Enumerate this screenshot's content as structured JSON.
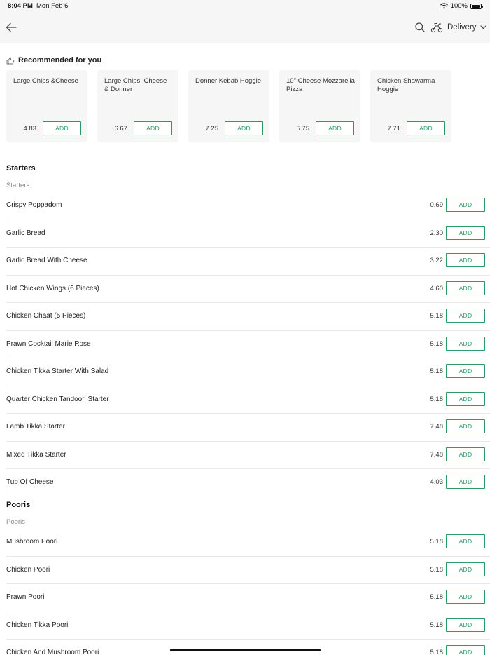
{
  "status": {
    "time": "8:04 PM",
    "date": "Mon Feb 6",
    "battery": "100%",
    "wifi_icon": "wifi-icon",
    "battery_icon": "battery-icon"
  },
  "header": {
    "back_icon": "arrow-left-icon",
    "search_icon": "search-icon",
    "mode_icon": "scooter-icon",
    "mode_label": "Delivery",
    "dropdown_icon": "chevron-down-icon"
  },
  "recommended": {
    "title": "Recommended for you",
    "icon": "thumbs-up-icon",
    "items": [
      {
        "name": "Large Chips &Cheese",
        "price": "4.83",
        "add_label": "ADD"
      },
      {
        "name": "Large Chips, Cheese & Donner",
        "price": "6.67",
        "add_label": "ADD"
      },
      {
        "name": "Donner Kebab Hoggie",
        "price": "7.25",
        "add_label": "ADD"
      },
      {
        "name": "10\" Cheese Mozzarella Pizza",
        "price": "5.75",
        "add_label": "ADD"
      },
      {
        "name": "Chicken Shawarma Hoggie",
        "price": "7.71",
        "add_label": "ADD"
      }
    ]
  },
  "sections": [
    {
      "title": "Starters",
      "subtitle": "Starters",
      "items": [
        {
          "name": "Crispy Poppadom",
          "price": "0.69",
          "add_label": "ADD"
        },
        {
          "name": "Garlic Bread",
          "price": "2.30",
          "add_label": "ADD"
        },
        {
          "name": "Garlic Bread With Cheese",
          "price": "3.22",
          "add_label": "ADD"
        },
        {
          "name": "Hot Chicken Wings (6 Pieces)",
          "price": "4.60",
          "add_label": "ADD"
        },
        {
          "name": "Chicken Chaat (5 Pieces)",
          "price": "5.18",
          "add_label": "ADD"
        },
        {
          "name": "Prawn Cocktail Marie Rose",
          "price": "5.18",
          "add_label": "ADD"
        },
        {
          "name": "Chicken Tikka Starter With Salad",
          "price": "5.18",
          "add_label": "ADD"
        },
        {
          "name": "Quarter Chicken Tandoori Starter",
          "price": "5.18",
          "add_label": "ADD"
        },
        {
          "name": "Lamb Tikka Starter",
          "price": "7.48",
          "add_label": "ADD"
        },
        {
          "name": "Mixed Tikka Starter",
          "price": "7.48",
          "add_label": "ADD"
        },
        {
          "name": "Tub Of Cheese",
          "price": "4.03",
          "add_label": "ADD"
        }
      ]
    },
    {
      "title": "Pooris",
      "subtitle": "Pooris",
      "items": [
        {
          "name": "Mushroom Poori",
          "price": "5.18",
          "add_label": "ADD"
        },
        {
          "name": "Chicken Poori",
          "price": "5.18",
          "add_label": "ADD"
        },
        {
          "name": "Prawn Poori",
          "price": "5.18",
          "add_label": "ADD"
        },
        {
          "name": "Chicken Tikka Poori",
          "price": "5.18",
          "add_label": "ADD"
        },
        {
          "name": "Chicken And Mushroom Poori",
          "price": "5.18",
          "add_label": "ADD"
        }
      ]
    }
  ],
  "colors": {
    "accent": "#2d9a62",
    "header_bg": "#f6f6f6",
    "card_bg": "#f6f6f6",
    "divider": "#e8e8e8"
  }
}
